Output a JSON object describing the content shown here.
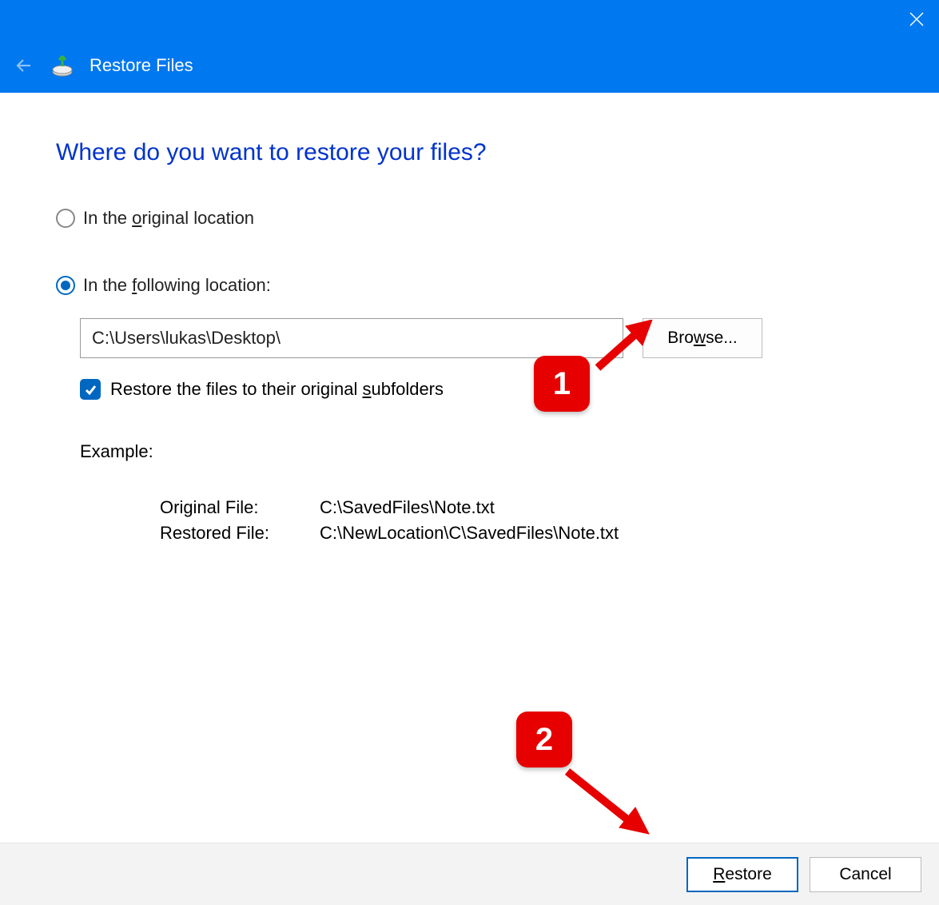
{
  "header": {
    "title": "Restore Files"
  },
  "main": {
    "heading": "Where do you want to restore your files?",
    "option_original_pre": "In the ",
    "option_original_u": "o",
    "option_original_post": "riginal location",
    "option_following_pre": "In the ",
    "option_following_u": "f",
    "option_following_post": "ollowing location:",
    "path_value": "C:\\Users\\lukas\\Desktop\\",
    "browse_pre": "Bro",
    "browse_u": "w",
    "browse_post": "se...",
    "restore_sub_pre": "Restore the files to their original ",
    "restore_sub_u": "s",
    "restore_sub_post": "ubfolders",
    "example_label": "Example:",
    "example_original_label": "Original File:",
    "example_original_value": "C:\\SavedFiles\\Note.txt",
    "example_restored_label": "Restored File:",
    "example_restored_value": "C:\\NewLocation\\C\\SavedFiles\\Note.txt"
  },
  "footer": {
    "restore_u": "R",
    "restore_post": "estore",
    "cancel_label": "Cancel"
  },
  "annotations": {
    "callout1": "1",
    "callout2": "2"
  }
}
